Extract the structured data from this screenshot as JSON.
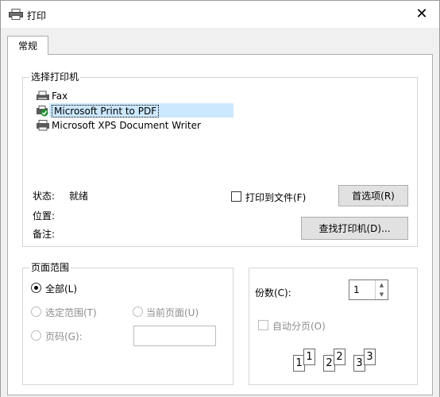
{
  "window": {
    "title": "打印",
    "close_label": "✕"
  },
  "tabs": [
    {
      "label": "常规"
    }
  ],
  "select_printer": {
    "group_label": "选择打印机",
    "printers": [
      {
        "name": "Fax"
      },
      {
        "name": "Microsoft Print to PDF",
        "selected": true
      },
      {
        "name": "Microsoft XPS Document Writer"
      }
    ]
  },
  "status": {
    "status_label": "状态:",
    "status_value": "就绪",
    "location_label": "位置:",
    "comment_label": "备注:"
  },
  "print_to_file": {
    "label": "打印到文件(F)",
    "checked": false
  },
  "buttons": {
    "preferences": "首选项(R)",
    "find_printer": "查找打印机(D)..."
  },
  "page_range": {
    "group_label": "页面范围",
    "all_label": "全部(L)",
    "selection_label": "选定范围(T)",
    "current_page_label": "当前页面(U)",
    "pages_label": "页码(G):",
    "pages_value": ""
  },
  "copies": {
    "label": "份数(C):",
    "value": "1",
    "collate_label": "自动分页(O)",
    "collate_checked": false,
    "collate_pages": [
      "1",
      "1",
      "2",
      "2",
      "3",
      "3"
    ]
  },
  "colors": {
    "selection": "#cce8ff",
    "disabled_text": "#8d8d8d"
  }
}
